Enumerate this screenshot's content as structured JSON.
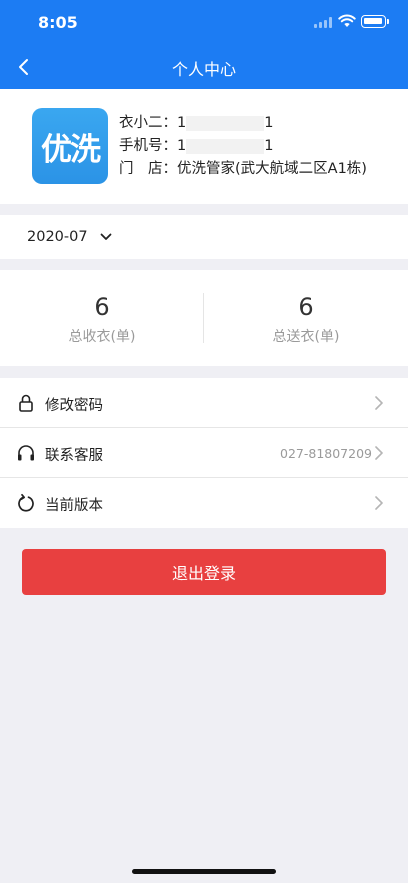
{
  "status_bar": {
    "time": "8:05"
  },
  "nav": {
    "title": "个人中心",
    "back_icon": "chevron-left-icon"
  },
  "profile": {
    "logo_text": "优洗",
    "staff_label": "衣小二：",
    "staff_prefix": "1",
    "staff_suffix": "1",
    "phone_label": "手机号：",
    "phone_prefix": "1",
    "phone_suffix": "1",
    "store_label": "门　店：",
    "store_value": "优洗管家(武大航域二区A1栋)"
  },
  "date_filter": {
    "value": "2020-07",
    "icon": "chevron-down-icon"
  },
  "stats": [
    {
      "value": "6",
      "label": "总收衣(单)"
    },
    {
      "value": "6",
      "label": "总送衣(单)"
    }
  ],
  "menu": [
    {
      "label": "修改密码",
      "icon": "lock-icon",
      "value": ""
    },
    {
      "label": "联系客服",
      "icon": "headphones-icon",
      "value": "027-81807209"
    },
    {
      "label": "当前版本",
      "icon": "refresh-icon",
      "value": ""
    }
  ],
  "logout_label": "退出登录",
  "colors": {
    "primary": "#1c7cf3",
    "danger": "#e84040",
    "background": "#efeff4"
  }
}
